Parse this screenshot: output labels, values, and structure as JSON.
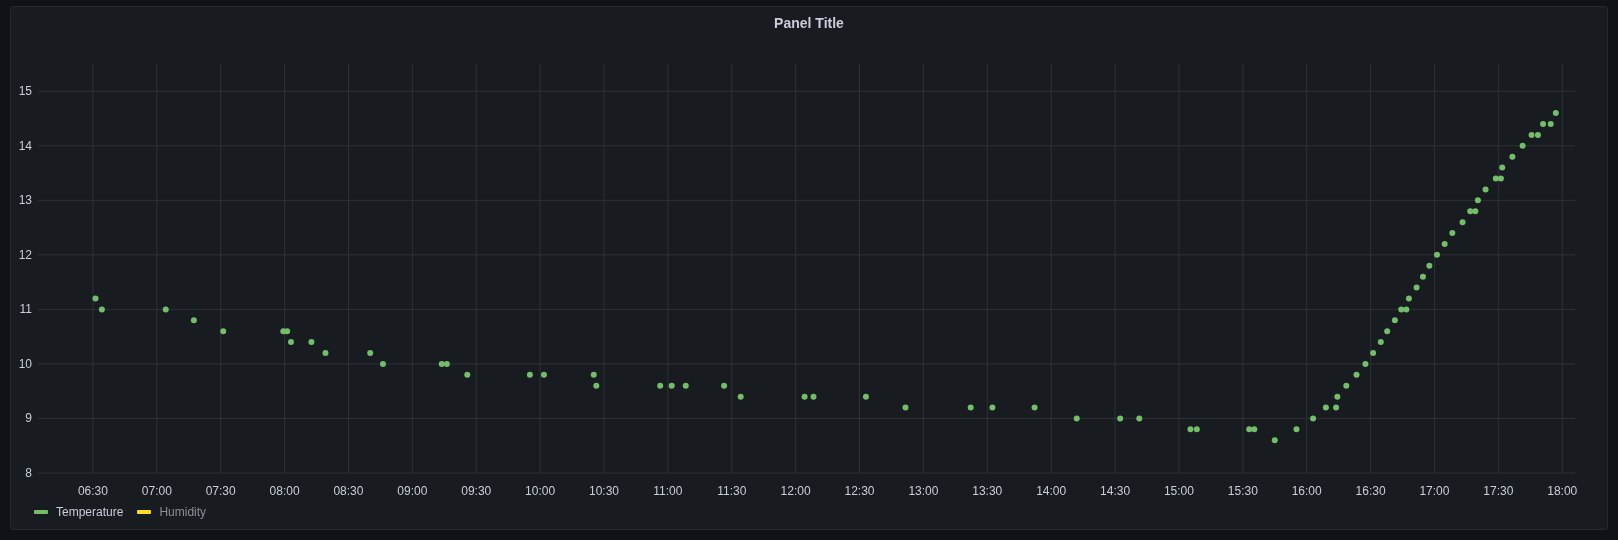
{
  "panel": {
    "title": "Panel Title",
    "chart_data": {
      "type": "scatter",
      "grid": true,
      "xlim": [
        6.07,
        18.1
      ],
      "ylim": [
        8,
        15.5
      ],
      "xticks": [
        {
          "value": 6.5,
          "label": "06:30"
        },
        {
          "value": 7,
          "label": "07:00"
        },
        {
          "value": 7.5,
          "label": "07:30"
        },
        {
          "value": 8,
          "label": "08:00"
        },
        {
          "value": 8.5,
          "label": "08:30"
        },
        {
          "value": 9,
          "label": "09:00"
        },
        {
          "value": 9.5,
          "label": "09:30"
        },
        {
          "value": 10,
          "label": "10:00"
        },
        {
          "value": 10.5,
          "label": "10:30"
        },
        {
          "value": 11,
          "label": "11:00"
        },
        {
          "value": 11.5,
          "label": "11:30"
        },
        {
          "value": 12,
          "label": "12:00"
        },
        {
          "value": 12.5,
          "label": "12:30"
        },
        {
          "value": 13,
          "label": "13:00"
        },
        {
          "value": 13.5,
          "label": "13:30"
        },
        {
          "value": 14,
          "label": "14:00"
        },
        {
          "value": 14.5,
          "label": "14:30"
        },
        {
          "value": 15,
          "label": "15:00"
        },
        {
          "value": 15.5,
          "label": "15:30"
        },
        {
          "value": 16,
          "label": "16:00"
        },
        {
          "value": 16.5,
          "label": "16:30"
        },
        {
          "value": 17,
          "label": "17:00"
        },
        {
          "value": 17.5,
          "label": "17:30"
        },
        {
          "value": 18,
          "label": "18:00"
        }
      ],
      "yticks": [
        {
          "value": 8,
          "label": "8"
        },
        {
          "value": 9,
          "label": "9"
        },
        {
          "value": 10,
          "label": "10"
        },
        {
          "value": 11,
          "label": "11"
        },
        {
          "value": 12,
          "label": "12"
        },
        {
          "value": 13,
          "label": "13"
        },
        {
          "value": 14,
          "label": "14"
        },
        {
          "value": 15,
          "label": "15"
        }
      ],
      "series": [
        {
          "name": "Temperature",
          "color": "#73bf69",
          "x": [
            6.52,
            6.57,
            7.07,
            7.29,
            7.52,
            7.99,
            8.02,
            8.05,
            8.21,
            8.32,
            8.67,
            8.77,
            9.23,
            9.27,
            9.43,
            9.92,
            10.03,
            10.42,
            10.44,
            10.94,
            11.03,
            11.14,
            11.44,
            11.57,
            12.07,
            12.14,
            12.55,
            12.86,
            13.37,
            13.54,
            13.87,
            14.2,
            14.54,
            14.69,
            15.09,
            15.14,
            15.55,
            15.59,
            15.75,
            15.92,
            16.05,
            16.15,
            16.23,
            16.24,
            16.31,
            16.39,
            16.46,
            16.52,
            16.58,
            16.63,
            16.69,
            16.74,
            16.78,
            16.8,
            16.86,
            16.91,
            16.96,
            17.02,
            17.08,
            17.14,
            17.22,
            17.28,
            17.32,
            17.34,
            17.4,
            17.48,
            17.52,
            17.53,
            17.61,
            17.69,
            17.76,
            17.81,
            17.85,
            17.91,
            17.95
          ],
          "values": [
            11.2,
            11,
            11,
            10.8,
            10.6,
            10.6,
            10.6,
            10.4,
            10.4,
            10.2,
            10.2,
            10,
            10,
            10,
            9.8,
            9.8,
            9.8,
            9.8,
            9.6,
            9.6,
            9.6,
            9.6,
            9.6,
            9.4,
            9.4,
            9.4,
            9.4,
            9.2,
            9.2,
            9.2,
            9.2,
            9,
            9,
            9,
            8.8,
            8.8,
            8.8,
            8.8,
            8.6,
            8.8,
            9,
            9.2,
            9.2,
            9.4,
            9.6,
            9.8,
            10,
            10.2,
            10.4,
            10.6,
            10.8,
            11,
            11,
            11.2,
            11.4,
            11.6,
            11.8,
            12,
            12.2,
            12.4,
            12.6,
            12.8,
            12.8,
            13,
            13.2,
            13.4,
            13.4,
            13.6,
            13.8,
            14,
            14.2,
            14.2,
            14.4,
            14.4,
            14.6
          ]
        }
      ]
    },
    "legend": {
      "items": [
        {
          "label": "Humidity",
          "color": "#fade2a",
          "hidden": true
        }
      ]
    }
  }
}
